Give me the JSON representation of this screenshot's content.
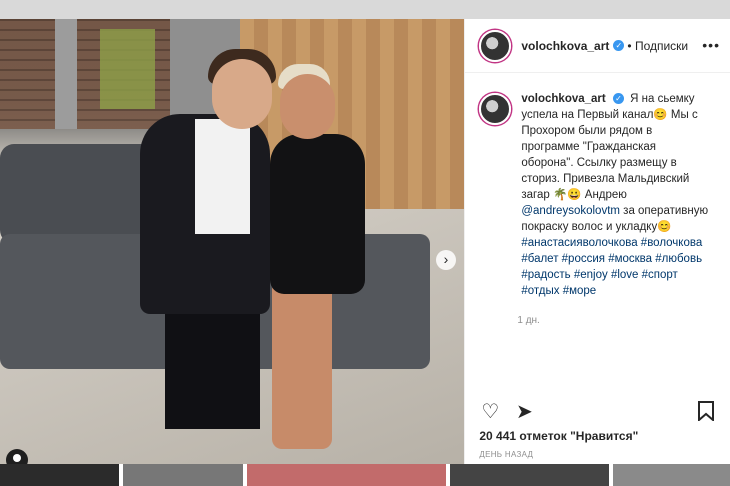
{
  "post": {
    "username": "volochkova_art",
    "verified_mark": "✓",
    "follow_label": "• Подписки",
    "more_label": "•••",
    "caption_user": "volochkova_art",
    "caption_text": "Я на сьемку успела на Первый канал😊 Мы с Прохором были рядом в программе \"Гражданская оборона\". Ссылку размещу в сториз. Привезла Мальдивский загар 🌴😀 Андрею",
    "mention": "@andreysokolovtm",
    "caption_tail": "за оперативную покраску волос и укладку😊",
    "hashtags": "#анастасияволочкова #волочкова #балет #россия #москва #любовь #радость #enjoy #love #спорт #отдых #море",
    "age": "1 дн.",
    "likes": "20 441 отметок \"Нравится\"",
    "date": "ДЕНЬ НАЗАД"
  },
  "icons": {
    "heart": "♡",
    "share": "➤",
    "bookmark": "🔖",
    "next": "›"
  },
  "carousel": {
    "total": 4,
    "active": 0
  }
}
